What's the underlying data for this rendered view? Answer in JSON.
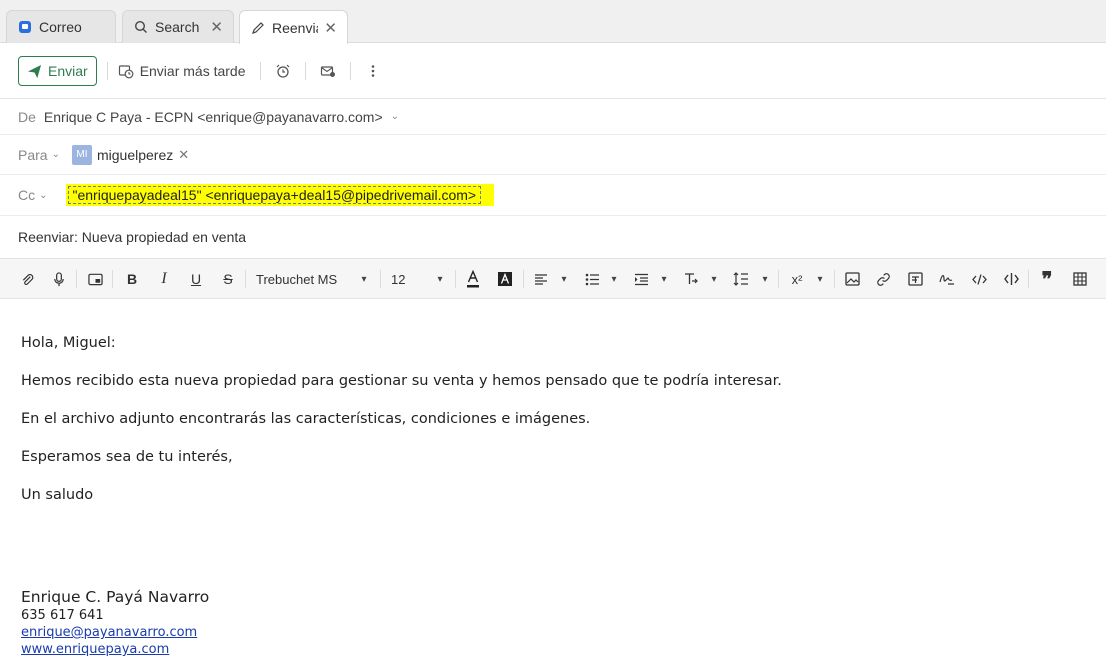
{
  "tabs": [
    {
      "label": "Correo",
      "icon": "mail-app-icon"
    },
    {
      "label": "Search",
      "icon": "search-icon"
    },
    {
      "label": "Reenviar: N",
      "icon": "pencil-icon"
    }
  ],
  "actions": {
    "send": "Enviar",
    "send_later": "Enviar más tarde"
  },
  "from": {
    "label": "De",
    "value": "Enrique C Paya - ECPN <enrique@payanavarro.com>"
  },
  "to": {
    "label": "Para",
    "avatar": "MI",
    "name": "miguelperez"
  },
  "cc": {
    "label": "Cc",
    "value": "\"enriquepayadeal15\" <enriquepaya+deal15@pipedrivemail.com>"
  },
  "subject": "Reenviar: Nueva propiedad en venta",
  "toolbar": {
    "font": "Trebuchet MS",
    "size": "12",
    "superscript": "x²"
  },
  "body": [
    "Hola, Miguel:",
    "Hemos recibido esta nueva propiedad para gestionar su venta y hemos pensado que te podría interesar.",
    "En el archivo adjunto encontrarás las características, condiciones e imágenes.",
    "Esperamos sea de tu interés,",
    "Un saludo"
  ],
  "signature": {
    "name": "Enrique C. Payá Navarro",
    "phone": "635 617 641",
    "email": "enrique@payanavarro.com",
    "web": "www.enriquepaya.com"
  },
  "colors": {
    "accent": "#2e7d4f",
    "highlight": "#ffff00",
    "link": "#1a3cad"
  }
}
